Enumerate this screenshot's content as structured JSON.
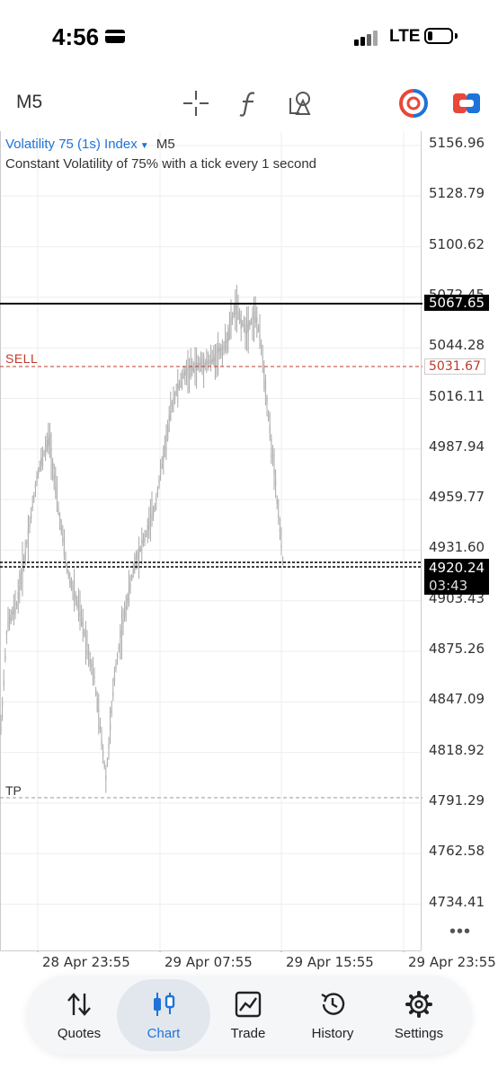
{
  "status_bar": {
    "time": "4:56",
    "network": "LTE"
  },
  "toolbar": {
    "timeframe": "M5",
    "icons": [
      "crosshair-icon",
      "function-icon",
      "objects-icon",
      "trade-toggle-icon",
      "one-click-icon"
    ]
  },
  "chart": {
    "symbol": "Volatility 75 (1s) Index",
    "timeframe": "M5",
    "description": "Constant Volatility of 75% with a tick every 1 second",
    "sell_label": "SELL",
    "tp_label": "TP",
    "price_axis": [
      "5156.96",
      "5128.79",
      "5100.62",
      "5072.45",
      "5044.28",
      "5016.11",
      "4987.94",
      "4959.77",
      "4931.60",
      "4903.43",
      "4875.26",
      "4847.09",
      "4818.92",
      "4791.29",
      "4762.58",
      "4734.41"
    ],
    "highlight_black": "5067.65",
    "highlight_sell": "5031.67",
    "current_price": "4920.24",
    "countdown": "03:43",
    "tp_price": "4791.29",
    "time_axis": [
      "28 Apr 23:55",
      "29 Apr 07:55",
      "29 Apr 15:55",
      "29 Apr 23:55"
    ],
    "more": "•••"
  },
  "colors": {
    "accent": "#1e73d8",
    "sell": "#c0392b",
    "candle": "#a8a8a8"
  },
  "nav": [
    {
      "label": "Quotes",
      "icon": "quotes-icon"
    },
    {
      "label": "Chart",
      "icon": "chart-icon",
      "active": true
    },
    {
      "label": "Trade",
      "icon": "trade-icon"
    },
    {
      "label": "History",
      "icon": "history-icon"
    },
    {
      "label": "Settings",
      "icon": "settings-icon"
    }
  ]
}
